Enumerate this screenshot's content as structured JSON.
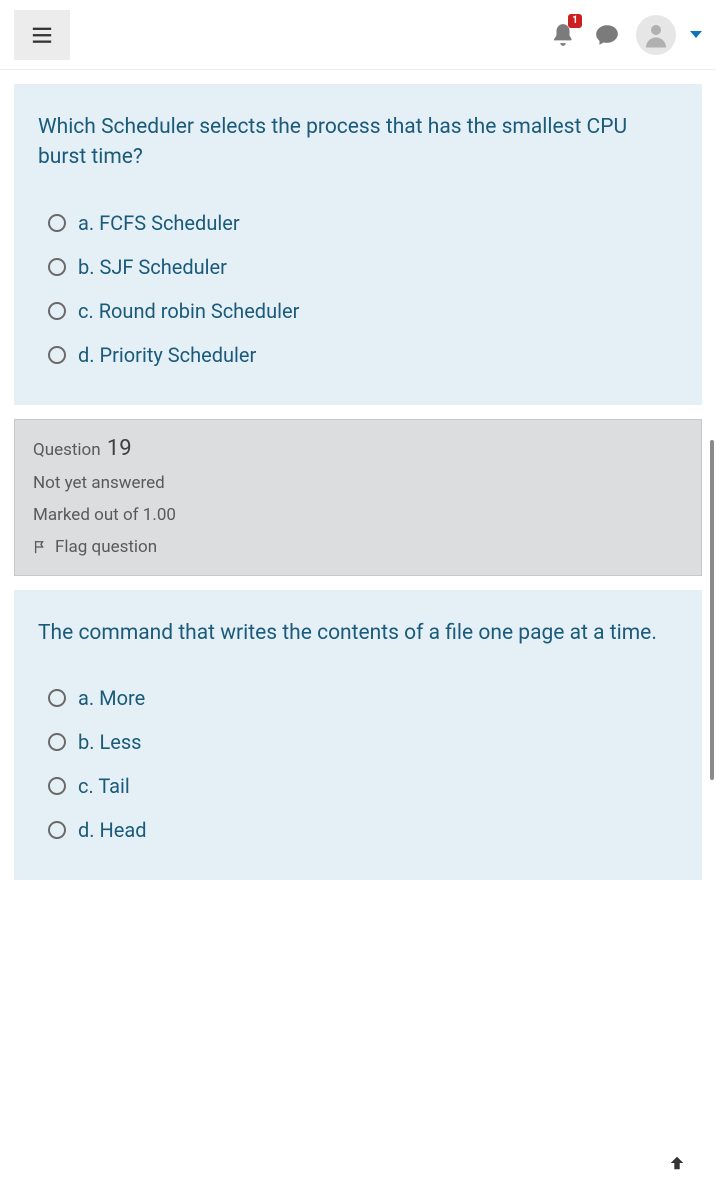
{
  "header": {
    "notification_count": "1"
  },
  "question18": {
    "text": "Which Scheduler selects the process that has the smallest CPU burst time?",
    "options": {
      "a": "a. FCFS Scheduler",
      "b": "b. SJF Scheduler",
      "c": "c. Round robin Scheduler",
      "d": "d. Priority Scheduler"
    }
  },
  "meta19": {
    "label": "Question",
    "number": "19",
    "status": "Not yet answered",
    "marks": "Marked out of 1.00",
    "flag": "Flag question"
  },
  "question19": {
    "text": "The command that writes the contents of a file one page at a time.",
    "options": {
      "a": "a. More",
      "b": "b. Less",
      "c": "c. Tail",
      "d": "d. Head"
    }
  }
}
